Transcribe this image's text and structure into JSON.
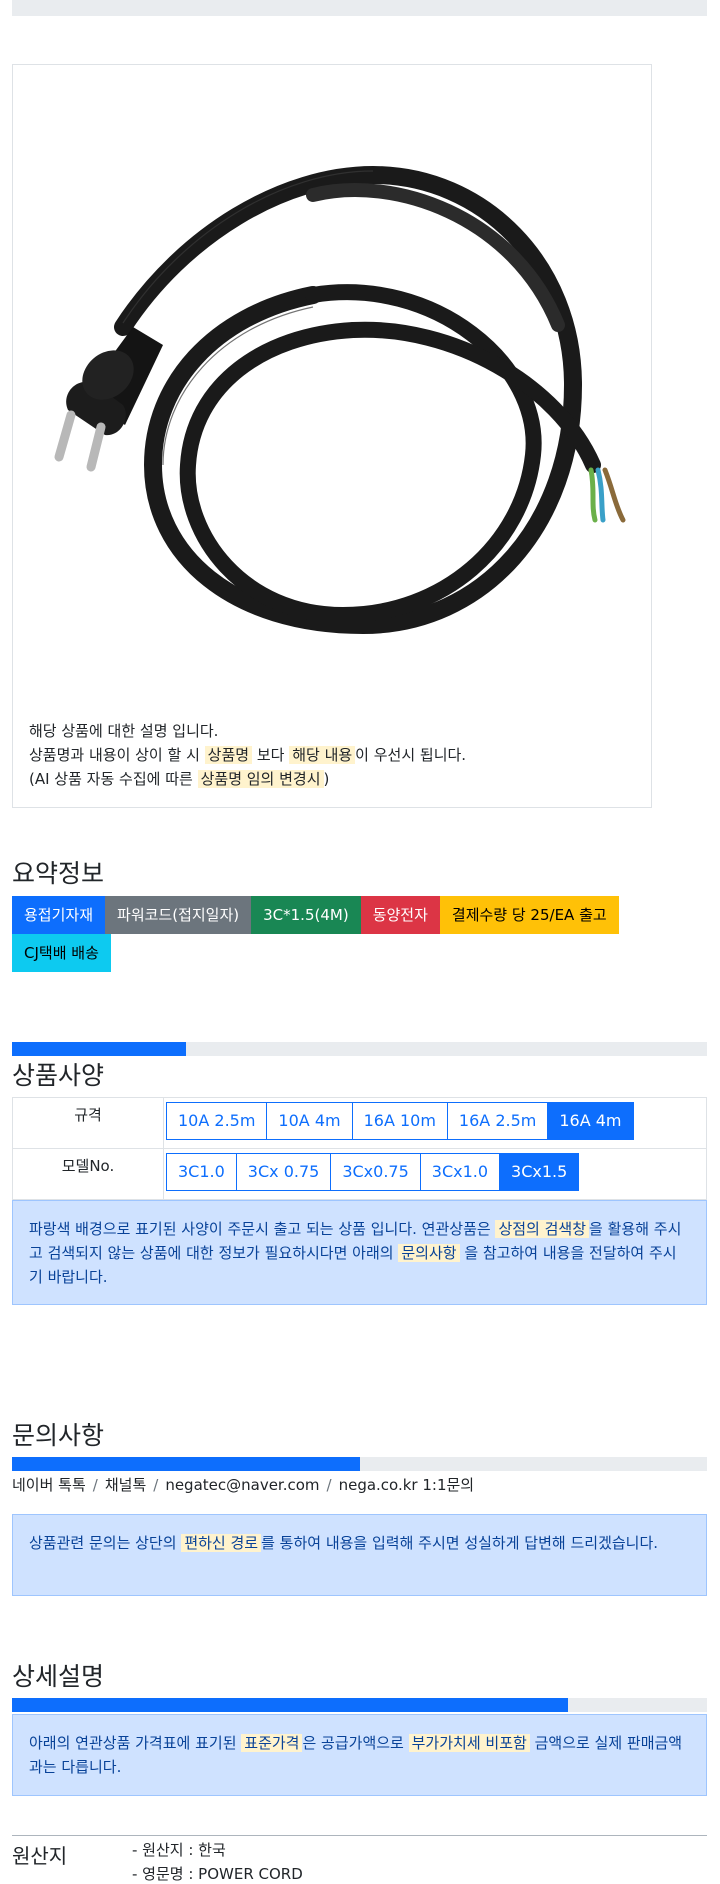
{
  "description": {
    "line1": "해당 상품에 대한 설명 입니다.",
    "line2_a": "상품명과 내용이 상이 할 시 ",
    "line2_hl1": "상품명",
    "line2_b": " 보다 ",
    "line2_hl2": "해당 내용",
    "line2_c": "이 우선시 됩니다.",
    "line3_a": "(AI 상품 자동 수집에 따른 ",
    "line3_hl": "상품명 임의 변경시",
    "line3_b": ")"
  },
  "summary": {
    "title": "요약정보",
    "tags": [
      {
        "label": "용접기자재",
        "color": "#0d6efd",
        "text_color": "#ffffff"
      },
      {
        "label": "파워코드(접지일자)",
        "color": "#6c757d",
        "text_color": "#ffffff"
      },
      {
        "label": "3C*1.5(4M)",
        "color": "#198754",
        "text_color": "#ffffff"
      },
      {
        "label": "동양전자",
        "color": "#dc3545",
        "text_color": "#ffffff"
      },
      {
        "label": "결제수량 당 25/EA 출고",
        "color": "#ffc107",
        "text_color": "#000000"
      },
      {
        "label": "CJ택배 배송",
        "color": "#0dcaf0",
        "text_color": "#000000"
      }
    ]
  },
  "specs": {
    "progress": 0.25,
    "title": "상품사양",
    "rows": [
      {
        "label": "규격",
        "options": [
          "10A 2.5m",
          "10A 4m",
          "16A 10m",
          "16A 2.5m",
          "16A 4m"
        ],
        "selected": 4
      },
      {
        "label": "모델No.",
        "options": [
          "3C1.0",
          "3Cx 0.75",
          "3Cx0.75",
          "3Cx1.0",
          "3Cx1.5"
        ],
        "selected": 4
      }
    ],
    "notice_a": "파랑색 배경으로 표기된 사양이 주문시 출고 되는 상품 입니다. 연관상품은 ",
    "notice_hl1": "상점의 검색창",
    "notice_b": "을 활용해 주시고 검색되지 않는 상품에 대한 정보가 필요하시다면 아래의 ",
    "notice_hl2": "문의사항",
    "notice_c": " 을 참고하여 내용을 전달하여 주시기 바랍니다."
  },
  "inquiry": {
    "title": "문의사항",
    "progress": 0.5,
    "contacts": [
      "네이버 톡톡",
      "채널톡",
      "negatec@naver.com",
      "nega.co.kr 1:1문의"
    ],
    "separator": "/",
    "notice_a": "상품관련 문의는 상단의 ",
    "notice_hl": "편하신 경로",
    "notice_b": "를 통하여 내용을 입력해 주시면 성실하게 답변해 드리겠습니다."
  },
  "detail": {
    "title": "상세설명",
    "progress": 0.8,
    "notice_a": "아래의 연관상품 가격표에 표기된 ",
    "notice_hl1": "표준가격",
    "notice_b": "은 공급가액으로 ",
    "notice_hl2": "부가가치세 비포함",
    "notice_c": " 금액으로 실제 판매금액과는 다릅니다."
  },
  "origin": {
    "title": "원산지",
    "lines": [
      "- 원산지 : 한국",
      "- 영문명 : POWER CORD"
    ]
  }
}
